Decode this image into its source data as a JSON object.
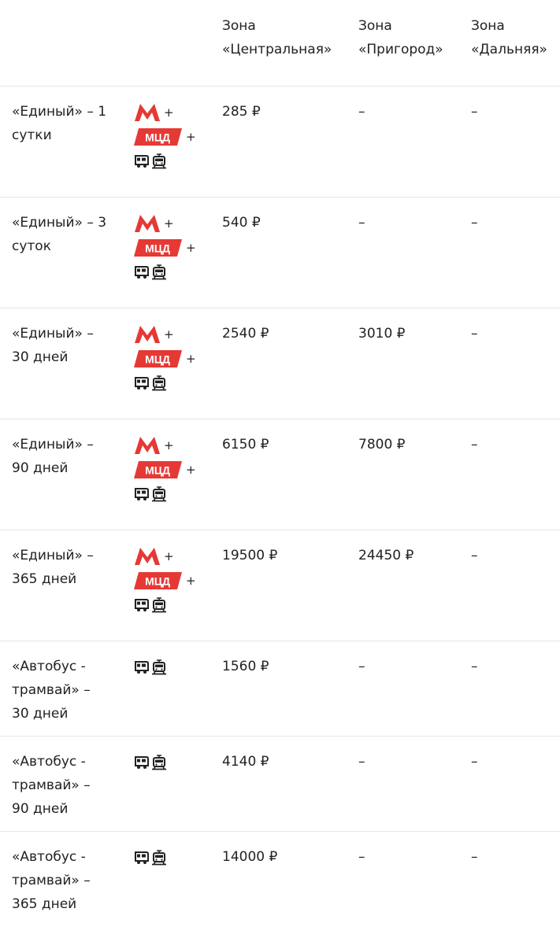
{
  "header": {
    "zone_label": "Зона",
    "zones": [
      "«Центральная»",
      "«Пригород»",
      "«Дальняя»"
    ]
  },
  "rows": [
    {
      "name": [
        "«Единый» – 1",
        "сутки"
      ],
      "modes": "all",
      "prices": [
        "285 ₽",
        "–",
        "–"
      ]
    },
    {
      "name": [
        "«Единый» – 3",
        "суток"
      ],
      "modes": "all",
      "prices": [
        "540 ₽",
        "–",
        "–"
      ]
    },
    {
      "name": [
        "«Единый» –",
        "30 дней"
      ],
      "modes": "all",
      "prices": [
        "2540 ₽",
        "3010 ₽",
        "–"
      ]
    },
    {
      "name": [
        "«Единый» –",
        "90 дней"
      ],
      "modes": "all",
      "prices": [
        "6150 ₽",
        "7800 ₽",
        "–"
      ]
    },
    {
      "name": [
        "«Единый» –",
        "365 дней"
      ],
      "modes": "all",
      "prices": [
        "19500 ₽",
        "24450 ₽",
        "–"
      ]
    },
    {
      "name": [
        "«Автобус -",
        "трамвай» –",
        "30 дней"
      ],
      "modes": "ground",
      "prices": [
        "1560 ₽",
        "–",
        "–"
      ]
    },
    {
      "name": [
        "«Автобус -",
        "трамвай» –",
        "90 дней"
      ],
      "modes": "ground",
      "prices": [
        "4140 ₽",
        "–",
        "–"
      ]
    },
    {
      "name": [
        "«Автобус -",
        "трамвай» –",
        "365 дней"
      ],
      "modes": "ground",
      "prices": [
        "14000 ₽",
        "–",
        "–"
      ]
    }
  ],
  "icons": {
    "metro": "metro-m-icon",
    "mcd": "mcd-icon",
    "mcd_text": "МЦД",
    "bus": "bus-icon",
    "tram": "tram-icon",
    "plus": "+"
  },
  "colors": {
    "accent_red": "#e53935",
    "text": "#222222",
    "divider": "#e6e6e6"
  }
}
